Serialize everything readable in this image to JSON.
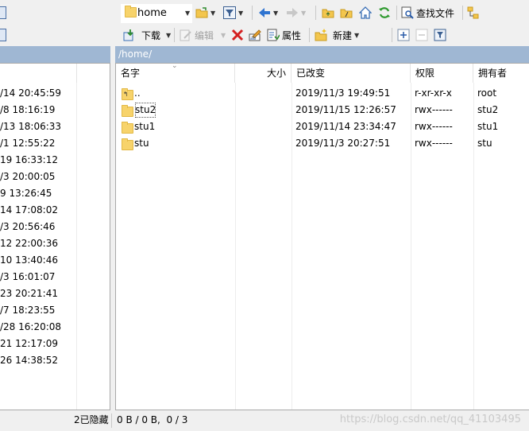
{
  "toolbar_top": {
    "location_value": "home",
    "find_files_label": "查找文件"
  },
  "toolbar_bottom": {
    "download_label": "下载",
    "edit_label": "编辑",
    "properties_label": "属性",
    "new_label": "新建"
  },
  "remote_panel": {
    "path": "/home/",
    "columns": [
      "名字",
      "大小",
      "已改变",
      "权限",
      "拥有者"
    ],
    "rows": [
      {
        "name": "..",
        "size": "",
        "changed": "2019/11/3 19:49:51",
        "rights": "r-xr-xr-x",
        "owner": "root",
        "icon": "parent-dir-icon"
      },
      {
        "name": "stu2",
        "size": "",
        "changed": "2019/11/15 12:26:57",
        "rights": "rwx------",
        "owner": "stu2",
        "icon": "folder-icon"
      },
      {
        "name": "stu1",
        "size": "",
        "changed": "2019/11/14 23:34:47",
        "rights": "rwx------",
        "owner": "stu1",
        "icon": "folder-icon"
      },
      {
        "name": "stu",
        "size": "",
        "changed": "2019/11/3 20:27:51",
        "rights": "rwx------",
        "owner": "stu",
        "icon": "folder-icon"
      }
    ]
  },
  "local_panel": {
    "times": [
      "/14  20:45:59",
      "/8  18:16:19",
      "/13  18:06:33",
      "/1  12:55:22",
      "19  16:33:12",
      "/3  20:00:05",
      "9  13:26:45",
      "14  17:08:02",
      "/3  20:56:46",
      "12  22:00:36",
      "10  13:40:46",
      "/3  16:01:07",
      "23  20:21:41",
      "/7  18:23:55",
      "/28  16:20:08",
      "21  12:17:09",
      "26  14:38:52"
    ]
  },
  "status": {
    "left_hidden": "2已隐藏",
    "right_summary": "0 B / 0 B,  0 / 3"
  },
  "watermark": "https://blog.csdn.net/qq_41103495",
  "colors": {
    "pathbar": "#9fb7d3",
    "folder": "#f7d36b"
  }
}
